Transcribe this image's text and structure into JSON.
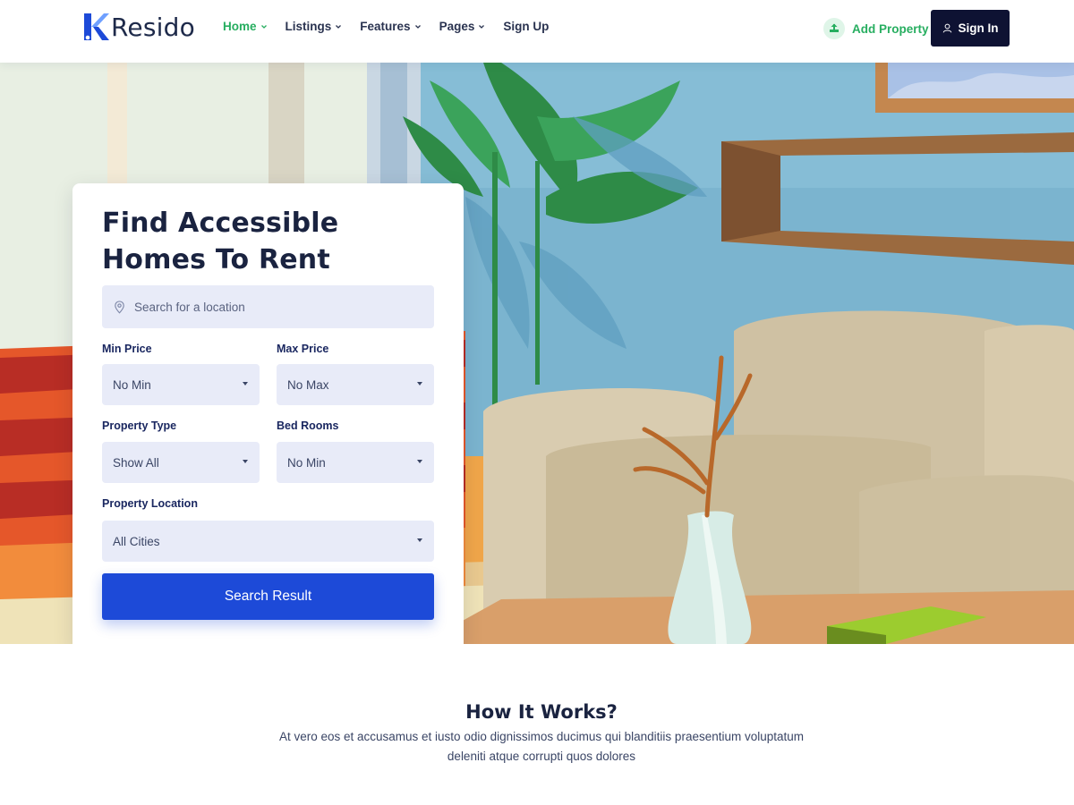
{
  "brand": {
    "name": "Resido"
  },
  "nav": {
    "items": [
      {
        "label": "Home",
        "has_dropdown": true,
        "active": true
      },
      {
        "label": "Listings",
        "has_dropdown": true,
        "active": false
      },
      {
        "label": "Features",
        "has_dropdown": true,
        "active": false
      },
      {
        "label": "Pages",
        "has_dropdown": true,
        "active": false
      },
      {
        "label": "Sign Up",
        "has_dropdown": false,
        "active": false
      }
    ],
    "add_property_label": "Add Property",
    "sign_in_label": "Sign In"
  },
  "search": {
    "title": "Find Accessible Homes To Rent",
    "location_placeholder": "Search for a location",
    "min_price": {
      "label": "Min Price",
      "value": "No Min"
    },
    "max_price": {
      "label": "Max Price",
      "value": "No Max"
    },
    "property_type": {
      "label": "Property Type",
      "value": "Show All"
    },
    "bed_rooms": {
      "label": "Bed Rooms",
      "value": "No Min"
    },
    "property_location": {
      "label": "Property Location",
      "value": "All Cities"
    },
    "button_label": "Search Result"
  },
  "how_it_works": {
    "title": "How It Works?",
    "description": "At vero eos et accusamus et iusto odio dignissimos ducimus qui blanditiis praesentium voluptatum deleniti atque corrupti quos dolores"
  },
  "colors": {
    "accent_green": "#27ae60",
    "primary_blue": "#1d4ad8",
    "navy": "#0e1233",
    "field_bg": "#e8ebf8"
  },
  "icons": {
    "logo": "resido-logo-mark",
    "location": "map-pin-icon",
    "add_property": "upload-home-icon",
    "sign_in": "user-icon",
    "dropdown": "chevron-down-icon"
  }
}
